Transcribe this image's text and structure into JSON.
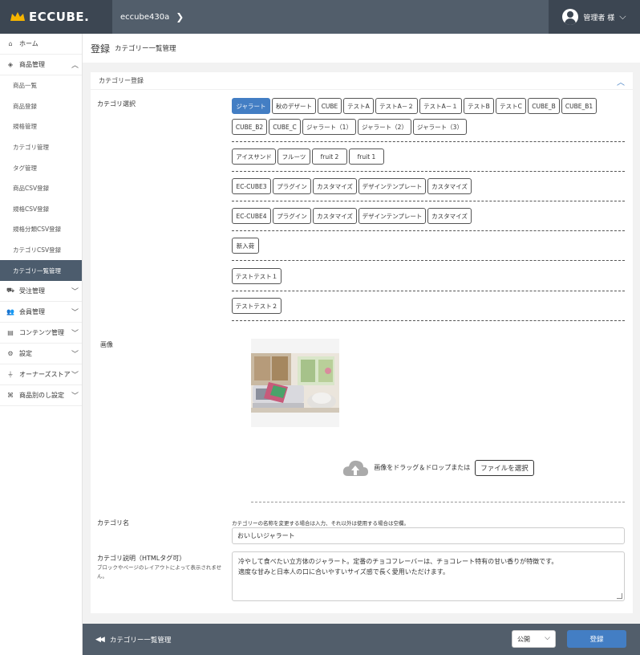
{
  "header": {
    "logo": "ECCUBE.",
    "shop_name": "eccube430a",
    "user_name": "管理者 様"
  },
  "sidebar": {
    "items": [
      {
        "label": "ホーム",
        "icon": "home-icon"
      },
      {
        "label": "商品管理",
        "icon": "cube-icon",
        "expanded": true
      },
      {
        "label": "受注管理",
        "icon": "cart-icon"
      },
      {
        "label": "会員管理",
        "icon": "users-icon"
      },
      {
        "label": "コンテンツ管理",
        "icon": "document-icon"
      },
      {
        "label": "設定",
        "icon": "gear-icon"
      },
      {
        "label": "オーナーズストア",
        "icon": "plug-icon"
      },
      {
        "label": "商品別のし設定",
        "icon": "gift-icon"
      }
    ],
    "sub_items": [
      "商品一覧",
      "商品登録",
      "規格管理",
      "カテゴリ管理",
      "タグ管理",
      "商品CSV登録",
      "規格CSV登録",
      "規格分類CSV登録",
      "カテゴリCSV登録",
      "カテゴリ一覧管理"
    ]
  },
  "page": {
    "title": "登録",
    "subtitle": "カテゴリー一覧管理"
  },
  "card": {
    "header": "カテゴリー登録",
    "label_category": "カテゴリ選択",
    "label_image": "画像",
    "label_name": "カテゴリ名",
    "label_desc": "カテゴリ説明（HTMLタグ可）",
    "label_desc_note": "ブロックやページのレイアウトによって表示されません。",
    "categories": [
      [
        "ジャラート",
        "秋のデザート",
        "CUBE",
        "テストA",
        "テストA－２",
        "テストA－１",
        "テストB",
        "テストC",
        "CUBE_B",
        "CUBE_B1",
        "CUBE_B2",
        "CUBE_C",
        "ジャラート（1）",
        "ジャラート（2）",
        "ジャラート（3）"
      ],
      [
        "アイスサンド",
        "フルーツ",
        "fruit 2",
        "fruit 1"
      ],
      [
        "EC-CUBE3",
        "プラグイン",
        "カスタマイズ",
        "デザインテンプレート",
        "カスタマイズ"
      ],
      [
        "EC-CUBE4",
        "プラグイン",
        "カスタマイズ",
        "デザインテンプレート",
        "カスタマイズ"
      ],
      [
        "新入荷"
      ],
      [
        "テストテスト１"
      ],
      [
        "テストテスト２"
      ]
    ],
    "drop_text": "画像をドラッグ＆ドロップまたは",
    "file_button": "ファイルを選択",
    "name_help": "カテゴリーの名称を変更する場合は入力、それ以外は使用する場合は空欄。",
    "name_value": "おいしいジャラート",
    "desc_value_line1": "冷やして食べたい立方体のジャラート。定番のチョコフレーバーは、チョコレート特有の甘い香りが特徴です。",
    "desc_value_line2": "適度な甘みと日本人の口に合いやすいサイズ感で長く愛用いただけます。"
  },
  "footer": {
    "back_label": "カテゴリー一覧管理",
    "status": "公開",
    "register": "登録"
  },
  "colors": {
    "primary": "#437ec4",
    "header_dark": "#3c4652",
    "header_mid": "#525e6b"
  }
}
